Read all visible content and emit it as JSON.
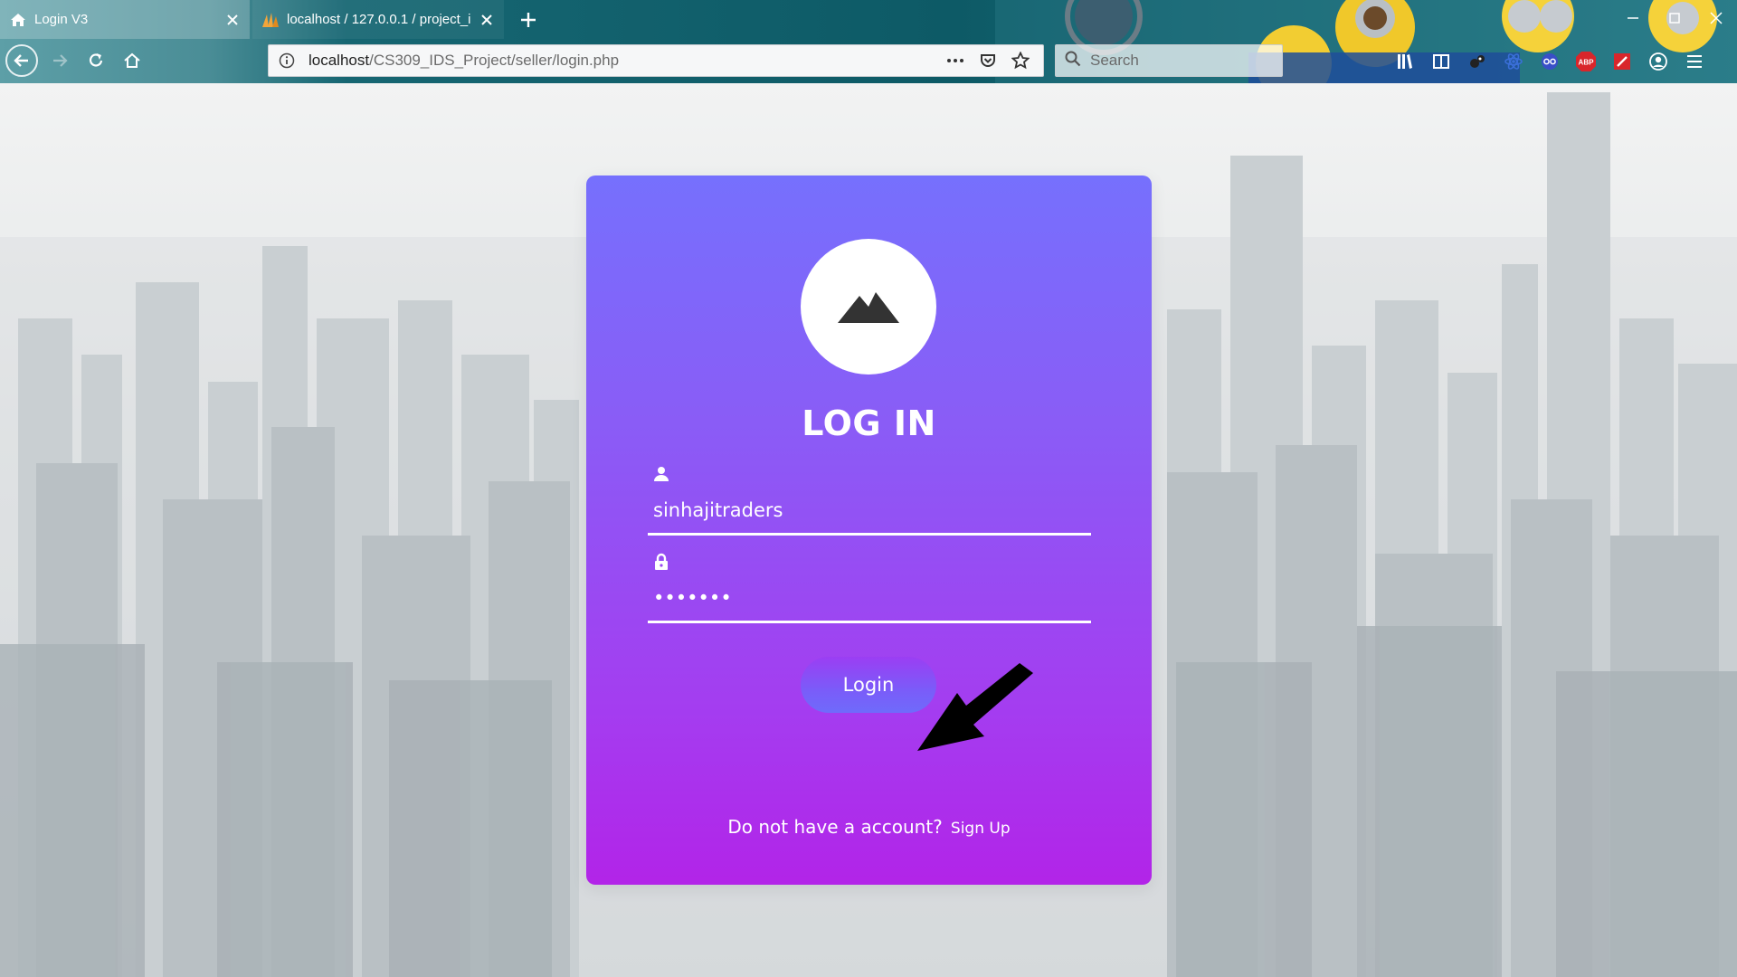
{
  "browser": {
    "tabs": [
      {
        "title": "Login V3",
        "icon": "home-icon",
        "active": true
      },
      {
        "title": "localhost / 127.0.0.1 / project_i",
        "icon": "phpmyadmin-icon",
        "active": false
      }
    ],
    "address": {
      "host": "localhost",
      "path": "/CS309_IDS_Project/seller/login.php"
    },
    "search_placeholder": "Search",
    "toolbar_icons": [
      "library-icon",
      "reader-icon",
      "extension-icon",
      "atom-icon",
      "glasses-icon",
      "adblock-icon",
      "pdf-icon",
      "account-icon",
      "menu-icon"
    ],
    "adblock_label": "ABP"
  },
  "login": {
    "title": "LOG IN",
    "username_value": "sinhajitraders",
    "password_value": "•••••••",
    "button_label": "Login",
    "signup_prompt": "Do not have a account?",
    "signup_link": "Sign Up"
  },
  "colors": {
    "card_top": "#7670fd",
    "card_bottom": "#b224e8",
    "chrome": "#0d5a66"
  }
}
